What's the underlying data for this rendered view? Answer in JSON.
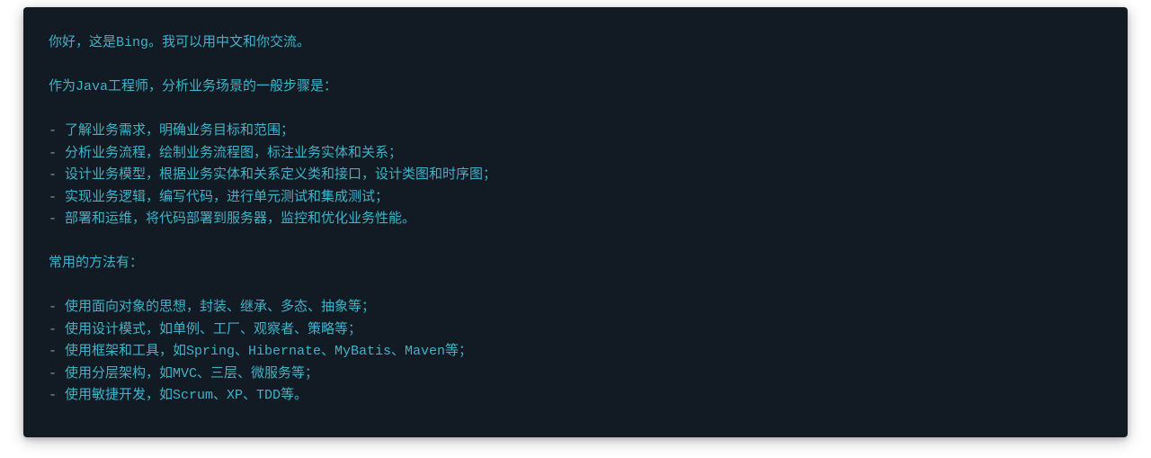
{
  "greeting": "你好，这是Bing。我可以用中文和你交流。",
  "intro": "作为Java工程师，分析业务场景的一般步骤是：",
  "steps": [
    "了解业务需求，明确业务目标和范围；",
    "分析业务流程，绘制业务流程图，标注业务实体和关系；",
    "设计业务模型，根据业务实体和关系定义类和接口，设计类图和时序图；",
    "实现业务逻辑，编写代码，进行单元测试和集成测试；",
    "部署和运维，将代码部署到服务器，监控和优化业务性能。"
  ],
  "methods_intro": "常用的方法有：",
  "methods": [
    "使用面向对象的思想，封装、继承、多态、抽象等；",
    "使用设计模式，如单例、工厂、观察者、策略等；",
    "使用框架和工具，如Spring、Hibernate、MyBatis、Maven等；",
    "使用分层架构，如MVC、三层、微服务等；",
    "使用敏捷开发，如Scrum、XP、TDD等。"
  ],
  "bullet": "- "
}
